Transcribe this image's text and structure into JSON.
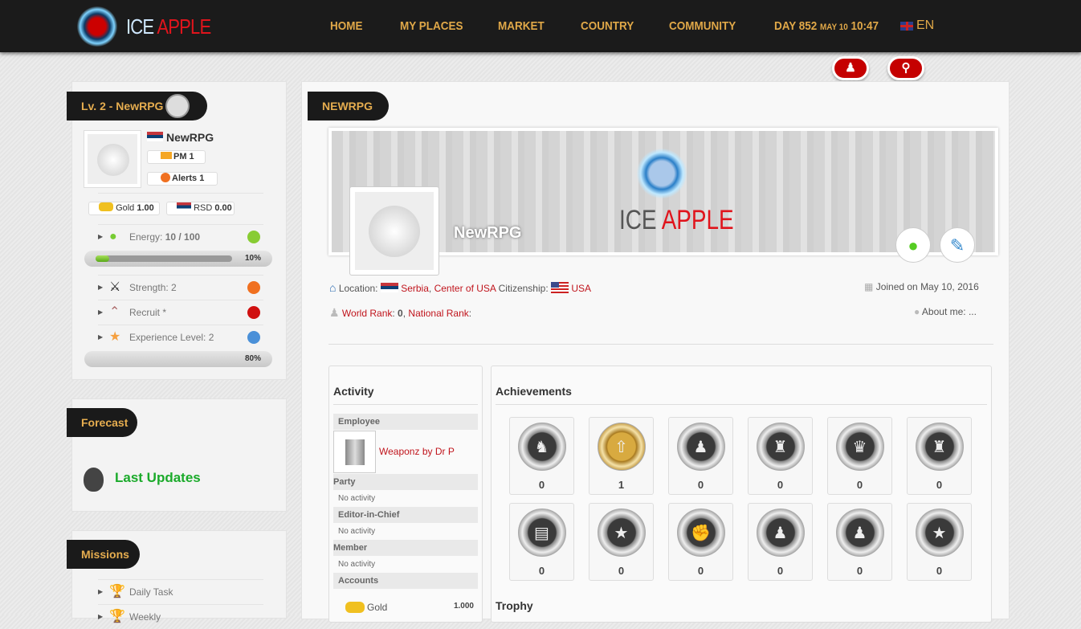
{
  "header": {
    "logo": {
      "ice": "ICE",
      "apple": "APPLE"
    },
    "nav": [
      "HOME",
      "MY PLACES",
      "MARKET",
      "COUNTRY",
      "COMMUNITY"
    ],
    "day_label": "DAY 852",
    "date": "MAY 10",
    "time": "10:47",
    "lang": "EN"
  },
  "colors": {
    "accent": "#e0a848",
    "red": "#c0141c",
    "green": "#1aaa2a",
    "header_bg": "#1b1b1b"
  },
  "sidebar": {
    "title": "Lv. 2 - NewRPG",
    "name": "NewRPG",
    "pm": "PM 1",
    "alerts": "Alerts 1",
    "gold_label": "Gold",
    "gold_value": "1.00",
    "rsd_label": "RSD",
    "rsd_value": "0.00",
    "energy_label": "Energy:",
    "energy_value": "10 / 100",
    "energy_percent": 10,
    "energy_percent_text": "10%",
    "strength": "Strength: 2",
    "rank": "Recruit *",
    "experience": "Experience Level: 2",
    "xp_percent": 80,
    "xp_percent_text": "80%",
    "forecast_title": "Forecast",
    "last_updates": "Last Updates",
    "missions_title": "Missions",
    "missions": [
      "Daily Task",
      "Weekly"
    ]
  },
  "profile": {
    "title": "NEWRPG",
    "banner_logo": {
      "ice": "ICE",
      "apple": "APPLE"
    },
    "name": "NewRPG",
    "location_label": "Location:",
    "location_country": "Serbia",
    "location_region": "Center of USA",
    "citizenship_label": "Citizenship:",
    "citizenship": "USA",
    "joined": "Joined on May 10, 2016",
    "world_rank_label": "World Rank",
    "world_rank": "0",
    "national_rank_label": "National Rank",
    "about": "About me: ..."
  },
  "activity": {
    "title": "Activity",
    "employee": "Employee",
    "company": "Weaponz by Dr P",
    "party": "Party",
    "editor": "Editor-in-Chief",
    "member": "Member",
    "no_activity": "No activity",
    "accounts": "Accounts",
    "gold_label": "Gold",
    "gold_value": "1.000"
  },
  "achievements": {
    "title": "Achievements",
    "values": [
      "0",
      "1",
      "0",
      "0",
      "0",
      "0",
      "0",
      "0",
      "0",
      "0",
      "0",
      "0"
    ],
    "trophy": "Trophy"
  }
}
